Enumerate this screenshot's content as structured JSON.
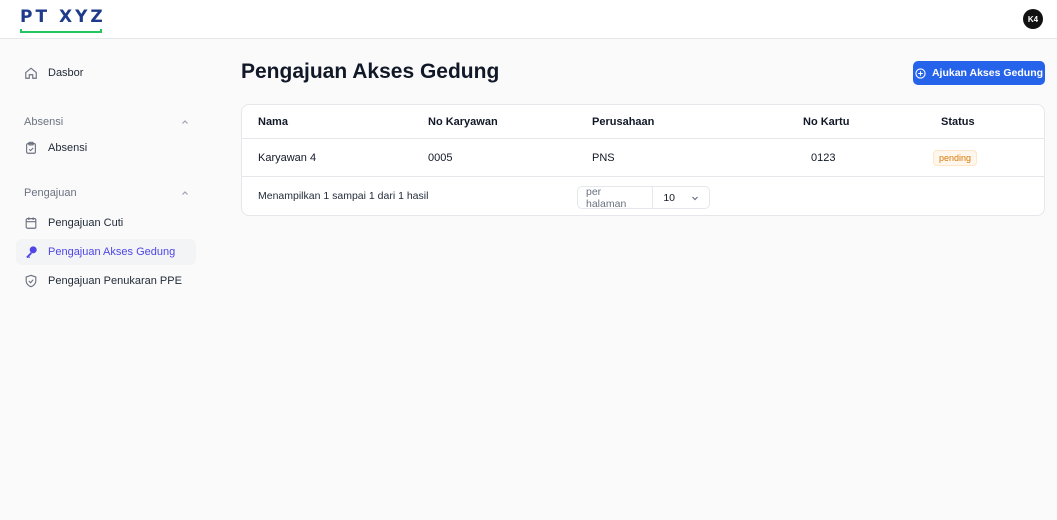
{
  "header": {
    "logo_text": "PT XYZ",
    "avatar_initials": "K4"
  },
  "sidebar": {
    "dashboard_label": "Dasbor",
    "groups": [
      {
        "label": "Absensi",
        "items": [
          {
            "label": "Absensi",
            "icon": "clipboard-icon"
          }
        ]
      },
      {
        "label": "Pengajuan",
        "items": [
          {
            "label": "Pengajuan Cuti",
            "icon": "calendar-icon"
          },
          {
            "label": "Pengajuan Akses Gedung",
            "icon": "key-icon",
            "active": true
          },
          {
            "label": "Pengajuan Penukaran PPE",
            "icon": "shield-check-icon"
          }
        ]
      }
    ]
  },
  "main": {
    "title": "Pengajuan Akses Gedung",
    "primary_button": "Ajukan Akses Gedung",
    "table": {
      "columns": [
        "Nama",
        "No Karyawan",
        "Perusahaan",
        "No Kartu",
        "Status"
      ],
      "rows": [
        {
          "name": "Karyawan 4",
          "employee_no": "0005",
          "company": "PNS",
          "card_no": "0123",
          "status": "pending"
        }
      ],
      "summary": "Menampilkan 1 sampai 1 dari 1 hasil",
      "per_page_label": "per halaman",
      "per_page_value": "10"
    }
  },
  "colors": {
    "accent": "#2563eb",
    "active_nav": "#4f46e5",
    "pending_badge": "#d97706",
    "logo": "#1e3a8a",
    "logo_underline": "#22c55e"
  }
}
